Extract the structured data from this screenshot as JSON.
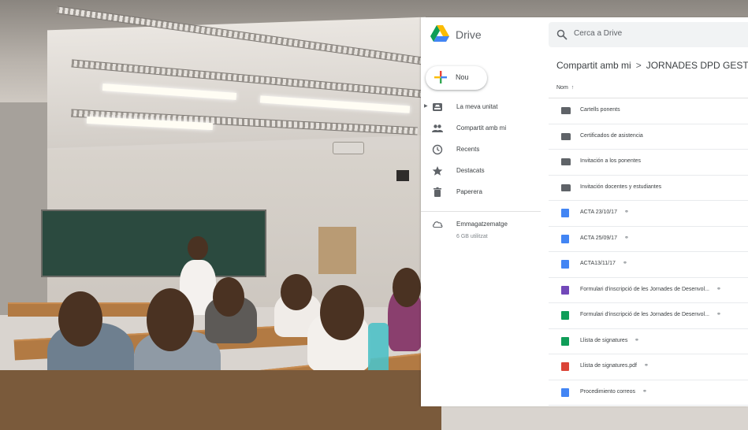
{
  "app": {
    "name": "Drive",
    "search_placeholder": "Cerca a Drive"
  },
  "sidebar": {
    "new_label": "Nou",
    "items": [
      {
        "label": "La meva unitat",
        "icon": "my-drive-icon"
      },
      {
        "label": "Compartit amb mi",
        "icon": "shared-people-icon"
      },
      {
        "label": "Recents",
        "icon": "clock-icon"
      },
      {
        "label": "Destacats",
        "icon": "star-icon"
      },
      {
        "label": "Paperera",
        "icon": "trash-icon"
      }
    ],
    "storage": {
      "label": "Emmagatzematge",
      "used": "6 GB utilitzat"
    }
  },
  "breadcrumb": {
    "root": "Compartit amb mi",
    "separator": ">",
    "current": "JORNADES DPD GESTI"
  },
  "list": {
    "sort_column": "Nom",
    "sort_arrow": "↑",
    "shared_glyph": "👥",
    "files": [
      {
        "name": "Cartells ponents",
        "type": "shared-folder",
        "shared": false
      },
      {
        "name": "Certificados de asistencia",
        "type": "shared-folder",
        "shared": false
      },
      {
        "name": "Invitación a los ponentes",
        "type": "shared-folder",
        "shared": false
      },
      {
        "name": "Invitación docentes y estudiantes",
        "type": "shared-folder",
        "shared": false
      },
      {
        "name": "ACTA 23/10/17",
        "type": "doc",
        "shared": true
      },
      {
        "name": "ACTA 25/09/17",
        "type": "doc",
        "shared": true
      },
      {
        "name": "ACTA13/11/17",
        "type": "doc",
        "shared": true
      },
      {
        "name": "Formulari d'inscripció de les Jornades de Desenvol...",
        "type": "form",
        "shared": true
      },
      {
        "name": "Formulari d'inscripció de les Jornades de Desenvol...",
        "type": "sheet",
        "shared": true
      },
      {
        "name": "Llista de signatures",
        "type": "sheet",
        "shared": true
      },
      {
        "name": "Llista de signatures.pdf",
        "type": "pdf",
        "shared": true
      },
      {
        "name": "Procedimiento correos",
        "type": "doc",
        "shared": true
      }
    ]
  },
  "colors": {
    "folder": "#5f6368",
    "doc": "#4285f4",
    "form": "#7248b9",
    "sheet": "#0f9d58",
    "pdf": "#db4437"
  }
}
